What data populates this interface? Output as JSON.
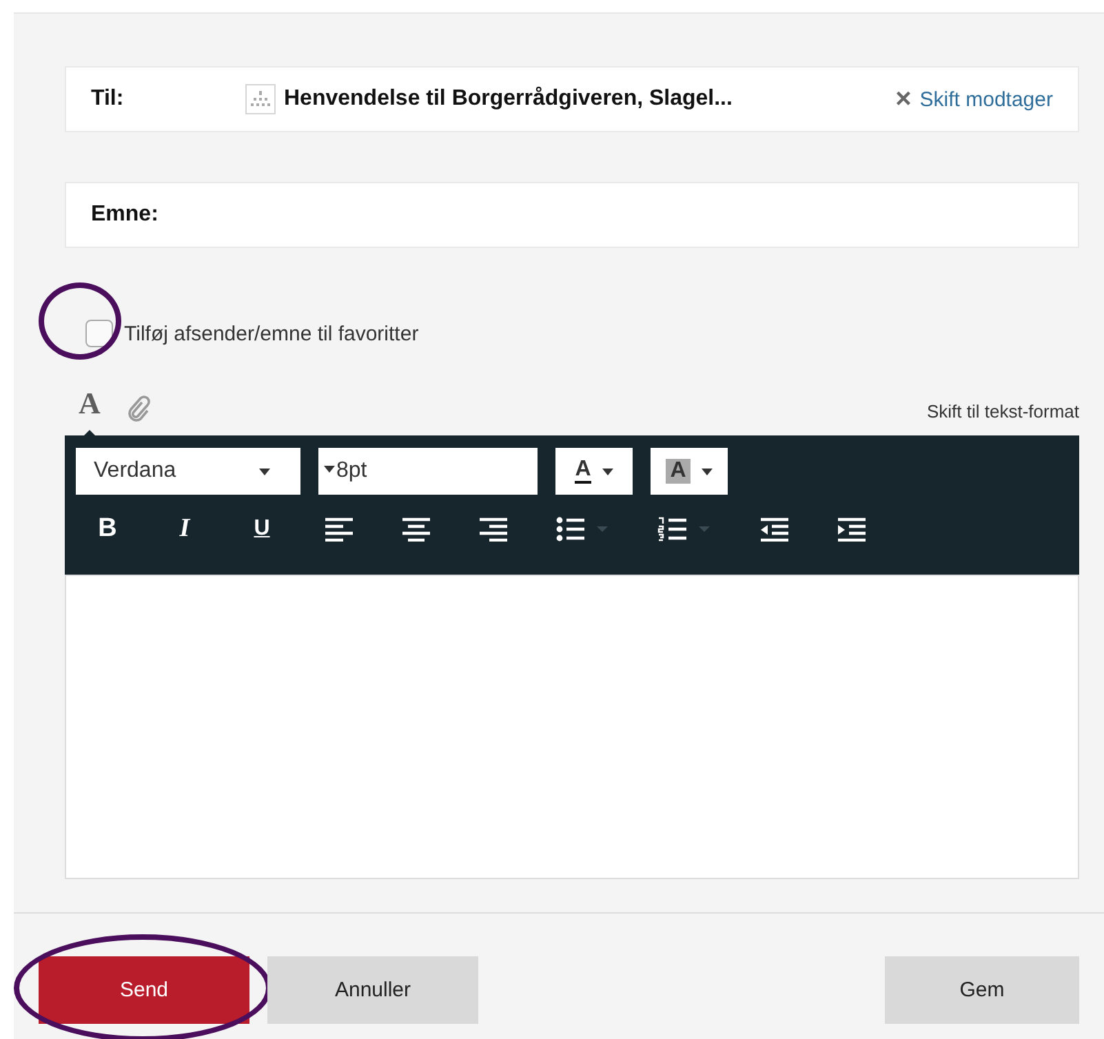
{
  "recipient": {
    "label": "Til:",
    "name": "Henvendelse til Borgerrådgiveren, Slagel...",
    "remove_icon": "×",
    "change_link": "Skift modtager"
  },
  "subject": {
    "label": "Emne:"
  },
  "favorite": {
    "label": "Tilføj afsender/emne til favoritter",
    "checked": false,
    "circled": true
  },
  "editor_tabs": [
    {
      "kind": "format",
      "label": "A",
      "selected": true
    },
    {
      "kind": "attach",
      "selected": false
    }
  ],
  "plain_text_link": "Skift til tekst-format",
  "toolbar": {
    "font": "Verdana",
    "size": "8pt",
    "color_buttons": [
      {
        "kind": "text-color",
        "label": "A"
      },
      {
        "kind": "highlight",
        "label": "A"
      }
    ],
    "buttons": [
      {
        "kind": "bold",
        "label": "B"
      },
      {
        "kind": "italic",
        "label": "I"
      },
      {
        "kind": "underline",
        "label": "U"
      },
      {
        "kind": "align-left"
      },
      {
        "kind": "align-center"
      },
      {
        "kind": "align-right"
      },
      {
        "kind": "bullet-list"
      },
      {
        "kind": "number-list"
      },
      {
        "kind": "outdent"
      },
      {
        "kind": "indent"
      }
    ]
  },
  "actions": [
    {
      "label": "Send",
      "kind": "primary",
      "circled": true
    },
    {
      "label": "Annuller",
      "kind": "secondary",
      "circled": false
    },
    {
      "label": "Gem",
      "kind": "secondary",
      "circled": false
    }
  ]
}
